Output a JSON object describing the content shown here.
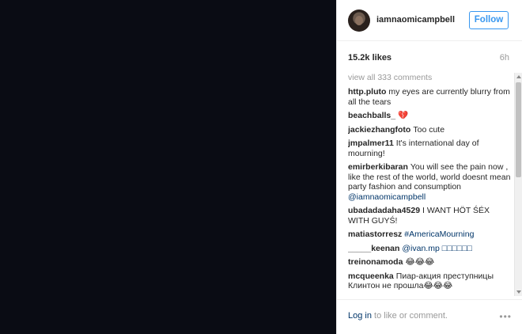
{
  "post": {
    "username": "iamnaomicampbell",
    "follow_label": "Follow",
    "likes": "15.2k likes",
    "time": "6h"
  },
  "comments": {
    "view_all": "view all 333 comments",
    "items": [
      {
        "user": "http.pluto",
        "text": "my eyes are currently blurry from all the tears"
      },
      {
        "user": "beachballs_",
        "text": "💔"
      },
      {
        "user": "jackiezhangfoto",
        "text": "Too cute"
      },
      {
        "user": "jmpalmer11",
        "text": "It's international day of mourning!"
      },
      {
        "user": "emirberkibaran",
        "text": "You will see the pain now , like the rest of the world, world doesnt mean party fashion and consumption",
        "mention": "@iamnaomicampbell"
      },
      {
        "user": "ubadadadaha4529",
        "text": "I WANT HÖT ŚÉX WITH GUYŚ!"
      },
      {
        "user": "matiastorresz",
        "text": "",
        "mention": "#AmericaMourning"
      },
      {
        "user": "_____keenan",
        "text": "",
        "mention": "@ivan.mp □□□□□□"
      },
      {
        "user": "treinonamoda",
        "text": "😂😂😂"
      },
      {
        "user": "mcqueenka",
        "text": "Пиар-акция преступницы Клинтон не прошла😂😂😂"
      }
    ]
  },
  "footer": {
    "login_label": "Log in",
    "login_suffix": " to like or comment.",
    "more_label": "•••"
  },
  "colors": {
    "accent": "#3897f0",
    "link": "#003569",
    "media_bg": "#0a0c14"
  }
}
